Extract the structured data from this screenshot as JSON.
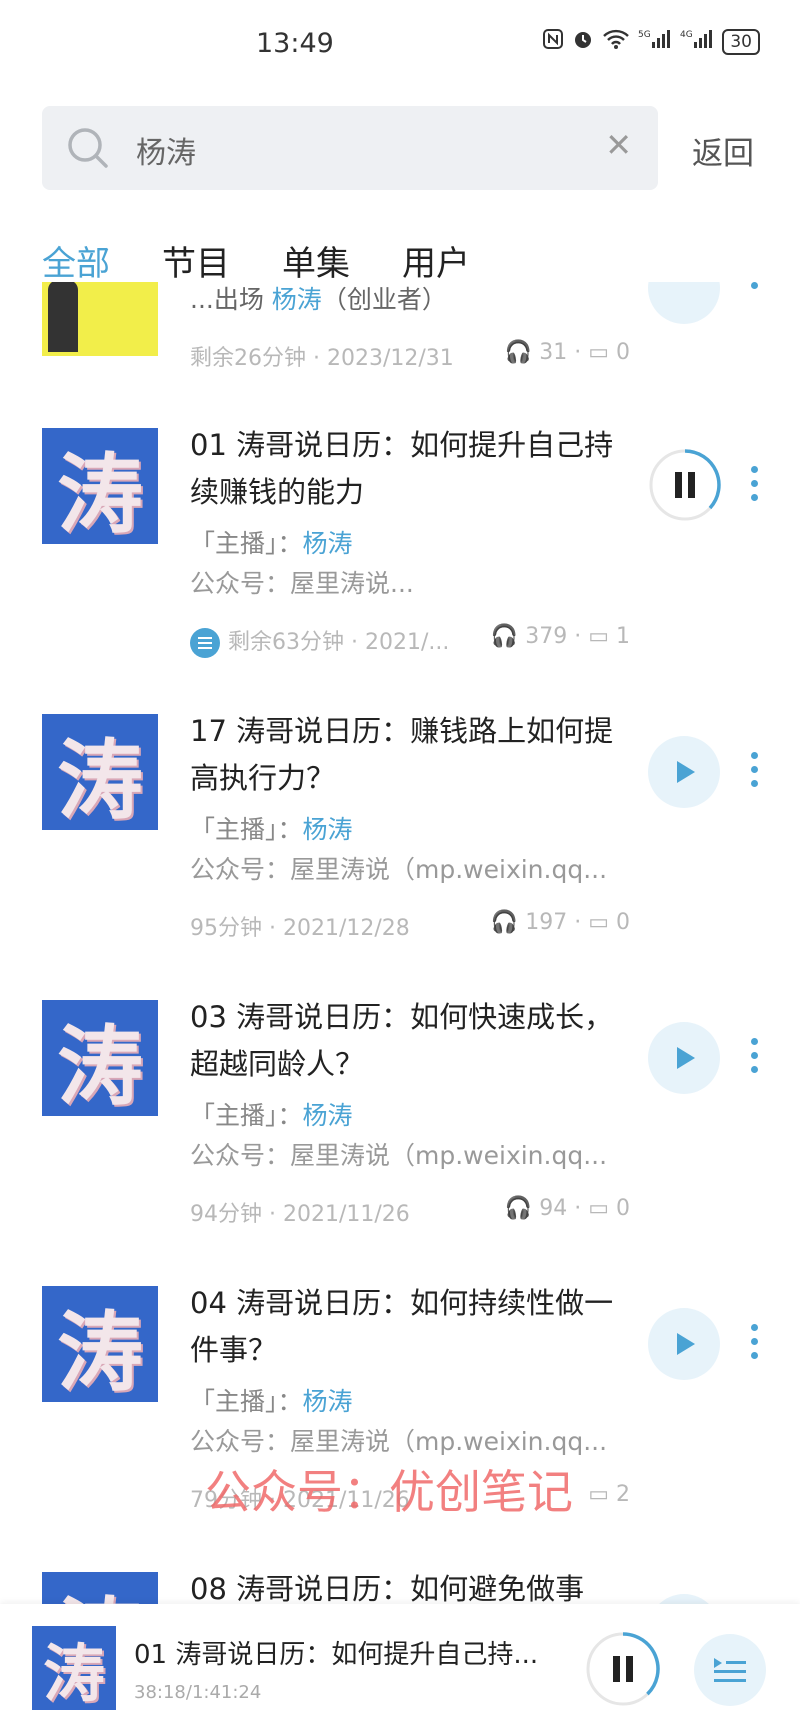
{
  "status_bar": {
    "time": "13:49",
    "icons": [
      "nfc-icon",
      "alarm-icon",
      "wifi-icon",
      "signal-5g-icon",
      "signal-4g-icon"
    ],
    "network_5g": "5G",
    "network_4g": "4G",
    "battery": "30"
  },
  "search": {
    "value": "杨涛",
    "back_label": "返回"
  },
  "tabs": [
    {
      "label": "全部",
      "active": true
    },
    {
      "label": "节目",
      "active": false
    },
    {
      "label": "单集",
      "active": false
    },
    {
      "label": "用户",
      "active": false
    }
  ],
  "partial_top_item": {
    "title_snippet_prefix": "...出场 ",
    "title_snippet_name": "杨涛",
    "title_snippet_suffix": "（创业者）",
    "meta": "剩余26分钟 · 2023/12/31",
    "plays": "31",
    "comments": "0"
  },
  "items": [
    {
      "title": "01 涛哥说日历：如何提升自己持续赚钱的能力",
      "host_label": "「主播」：",
      "host": "杨涛",
      "source": "公众号：屋里涛说...",
      "meta": "剩余63分钟 · 2021/...",
      "plays": "379",
      "comments": "1",
      "playing": true,
      "cover_char": "涛"
    },
    {
      "title": "17 涛哥说日历：赚钱路上如何提高执行力？",
      "host_label": "「主播」：",
      "host": "杨涛",
      "source": "公众号：屋里涛说（mp.weixin.qq...",
      "meta": "95分钟 · 2021/12/28",
      "plays": "197",
      "comments": "0",
      "playing": false,
      "cover_char": "涛"
    },
    {
      "title": "03 涛哥说日历：如何快速成长，超越同龄人？",
      "host_label": "「主播」：",
      "host": "杨涛",
      "source": "公众号：屋里涛说（mp.weixin.qq...",
      "meta": "94分钟 · 2021/11/26",
      "plays": "94",
      "comments": "0",
      "playing": false,
      "cover_char": "涛"
    },
    {
      "title": "04 涛哥说日历：如何持续性做一件事？",
      "host_label": "「主播」：",
      "host": "杨涛",
      "source": "公众号：屋里涛说（mp.weixin.qq...",
      "meta": "79分钟 · 2021/11/26",
      "plays": "",
      "comments": "2",
      "playing": false,
      "cover_char": "涛"
    },
    {
      "title": "08 涛哥说日历：如何避免做事",
      "cover_char": "涛"
    }
  ],
  "watermark": "公众号：优创笔记",
  "player": {
    "cover_char": "涛",
    "title": "01 涛哥说日历：如何提升自己持...",
    "time": "38:18/1:41:24",
    "progress": 0.377
  },
  "colors": {
    "accent": "#4aa3d4",
    "cover_bg": "#3467c9",
    "watermark": "#f06a6a"
  }
}
